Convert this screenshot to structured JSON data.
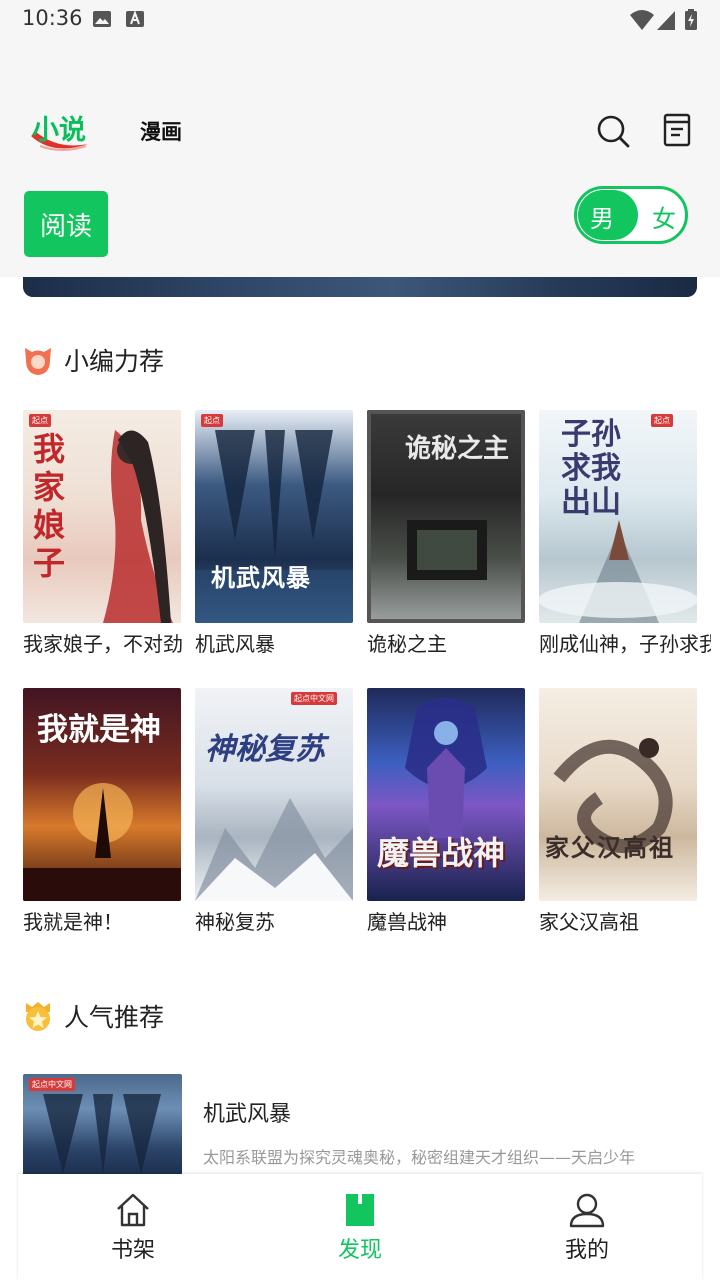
{
  "status_bar": {
    "time": "10:36"
  },
  "header": {
    "tabs": [
      {
        "label": "小说",
        "active": true
      },
      {
        "label": "漫画",
        "active": false
      }
    ],
    "read_button": "阅读",
    "gender": {
      "male": "男",
      "female": "女",
      "selected": "男"
    }
  },
  "editor_picks": {
    "title": "小编力荐",
    "books": [
      {
        "title": "我家娘子，不对劲",
        "cover_text": "我家娘子"
      },
      {
        "title": "机武风暴",
        "cover_text": "机武风暴"
      },
      {
        "title": "诡秘之主",
        "cover_text": "诡秘之主"
      },
      {
        "title": "刚成仙神，子孙求我出山",
        "cover_text": "子孙求我出山"
      },
      {
        "title": "我就是神！",
        "cover_text": "我就是神"
      },
      {
        "title": "神秘复苏",
        "cover_text": "神秘复苏"
      },
      {
        "title": "魔兽战神",
        "cover_text": "魔兽战神"
      },
      {
        "title": "家父汉高祖",
        "cover_text": "家父汉高祖"
      }
    ]
  },
  "popular": {
    "title": "人气推荐",
    "items": [
      {
        "title": "机武风暴",
        "description": "太阳系联盟为探究灵魂奥秘，秘密组建天才组织——天启少年"
      }
    ]
  },
  "bottom_nav": [
    {
      "label": "书架",
      "icon": "home-icon",
      "active": false
    },
    {
      "label": "发现",
      "icon": "bookmark-icon",
      "active": true
    },
    {
      "label": "我的",
      "icon": "user-icon",
      "active": false
    }
  ],
  "colors": {
    "accent": "#12c55e",
    "text": "#222222",
    "muted": "#999999"
  }
}
